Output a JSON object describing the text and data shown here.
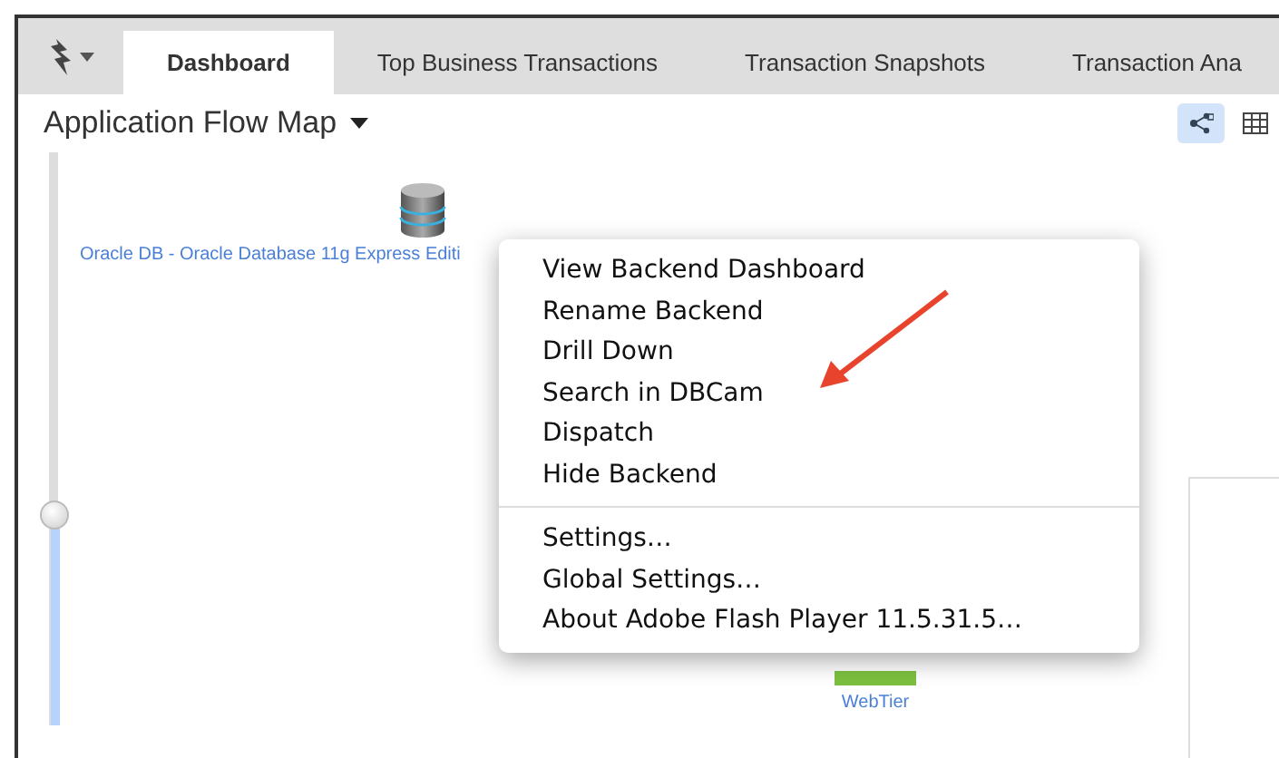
{
  "tabs": [
    {
      "label": "Dashboard",
      "selected": true
    },
    {
      "label": "Top Business Transactions",
      "selected": false
    },
    {
      "label": "Transaction Snapshots",
      "selected": false
    },
    {
      "label": "Transaction Ana",
      "selected": false
    }
  ],
  "view": {
    "title": "Application Flow Map",
    "view_buttons": [
      {
        "kind": "flow",
        "selected": true
      },
      {
        "kind": "grid",
        "selected": false
      }
    ]
  },
  "zoom_slider": {
    "level": 0.36
  },
  "nodes": [
    {
      "kind": "database",
      "label": "Oracle DB - Oracle Database 11g Express Editi"
    },
    {
      "kind": "tier",
      "label": "WebTier"
    }
  ],
  "context_menu": {
    "groups": [
      [
        "View Backend Dashboard",
        "Rename Backend",
        "Drill Down",
        "Search in DBCam",
        "Dispatch",
        "Hide Backend"
      ],
      [
        "Settings…",
        "Global Settings…",
        "About Adobe Flash Player 11.5.31.5…"
      ]
    ]
  }
}
